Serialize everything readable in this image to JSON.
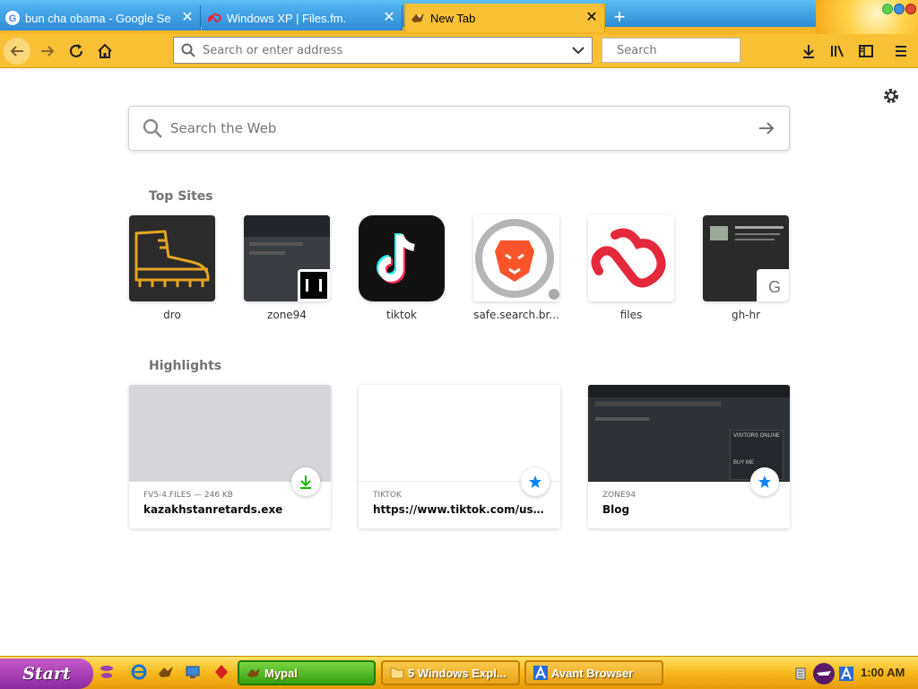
{
  "browser": {
    "tabs": [
      {
        "title": "bun cha obama - Google Se",
        "favicon": "google-g-icon",
        "active": false
      },
      {
        "title": "Windows XP | Files.fm.",
        "favicon": "filesfm-icon",
        "active": false
      },
      {
        "title": "New Tab",
        "favicon": "mypal-icon",
        "active": true
      }
    ],
    "new_tab_label": "+",
    "close_glyph": "✕"
  },
  "navbar": {
    "url_placeholder": "Search or enter address",
    "search_placeholder": "Search"
  },
  "newtab": {
    "web_search_placeholder": "Search the Web",
    "top_sites_heading": "Top Sites",
    "top_sites": [
      {
        "label": "dro",
        "icon": "boot-icon"
      },
      {
        "label": "zone94",
        "icon": "zone94-thumb"
      },
      {
        "label": "tiktok",
        "icon": "tiktok-icon"
      },
      {
        "label": "safe.search.br...",
        "icon": "brave-lion-icon"
      },
      {
        "label": "files",
        "icon": "filesfm-cloud-icon"
      },
      {
        "label": "gh-hr",
        "icon": "gh-hr-thumb",
        "letter": "G"
      }
    ],
    "highlights_heading": "Highlights",
    "highlights": [
      {
        "source": "FV5-4.FILES — 246 KB",
        "title": "kazakhstanretards.exe",
        "badge": "download-icon"
      },
      {
        "source": "TIKTOK",
        "title": "https://www.tiktok.com/us-land...",
        "badge": "bookmark-star-icon"
      },
      {
        "source": "ZONE94",
        "title": "Blog",
        "badge": "bookmark-star-icon"
      }
    ],
    "zone94_thumb": {
      "heading": "VISITORS ONLINE",
      "footer": "BUY ME"
    }
  },
  "taskbar": {
    "start_label": "Start",
    "tasks": [
      {
        "label": "Mypal",
        "active": true
      },
      {
        "label": "5 Windows Expl...",
        "active": false
      },
      {
        "label": "Avant Browser",
        "active": false
      }
    ],
    "clock": "1:00 AM"
  },
  "colors": {
    "toolbar": "#f8c035",
    "tiktok_bg": "#121212",
    "brave_orange": "#fb542b",
    "filesfm_red": "#e5283c",
    "star_blue": "#0a84ff",
    "download_green": "#12bc00"
  }
}
